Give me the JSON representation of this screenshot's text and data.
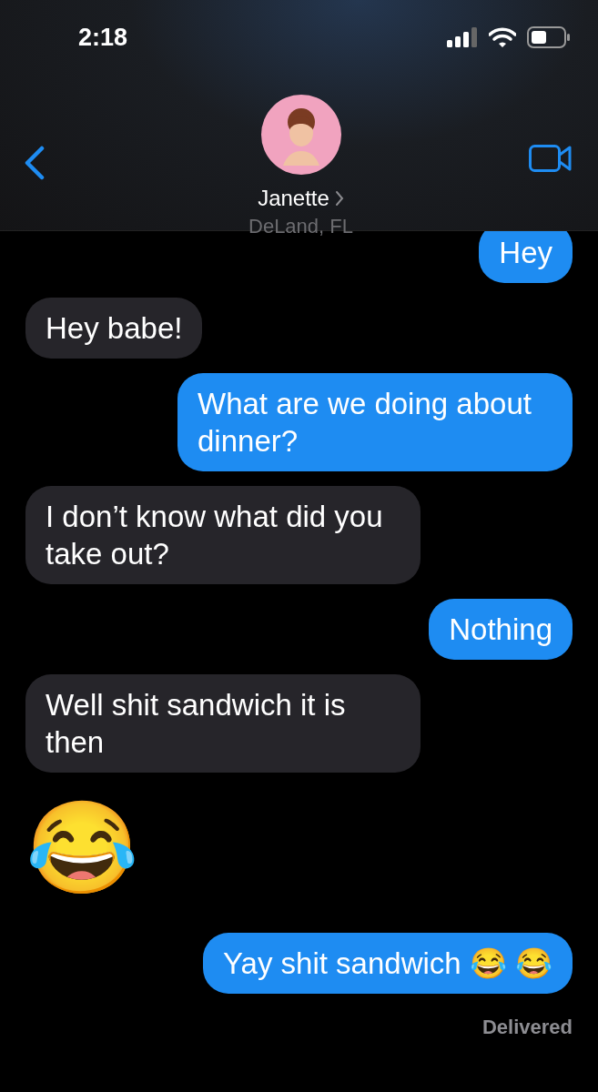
{
  "status_bar": {
    "time": "2:18"
  },
  "contact": {
    "name": "Janette",
    "location": "DeLand, FL"
  },
  "messages": [
    {
      "text": "Hey",
      "outgoing": true,
      "kind": "text"
    },
    {
      "text": "Hey babe!",
      "outgoing": false,
      "kind": "text"
    },
    {
      "text": "What are we doing about dinner?",
      "outgoing": true,
      "kind": "text"
    },
    {
      "text": "I don’t know what did you take out?",
      "outgoing": false,
      "kind": "text"
    },
    {
      "text": "Nothing",
      "outgoing": true,
      "kind": "text"
    },
    {
      "text": "Well shit sandwich it is then",
      "outgoing": false,
      "kind": "text"
    },
    {
      "text": "😂",
      "kind": "emoji"
    },
    {
      "text": "Yay shit sandwich 😂 😂",
      "outgoing": true,
      "kind": "text"
    }
  ],
  "receipt": "Delivered"
}
